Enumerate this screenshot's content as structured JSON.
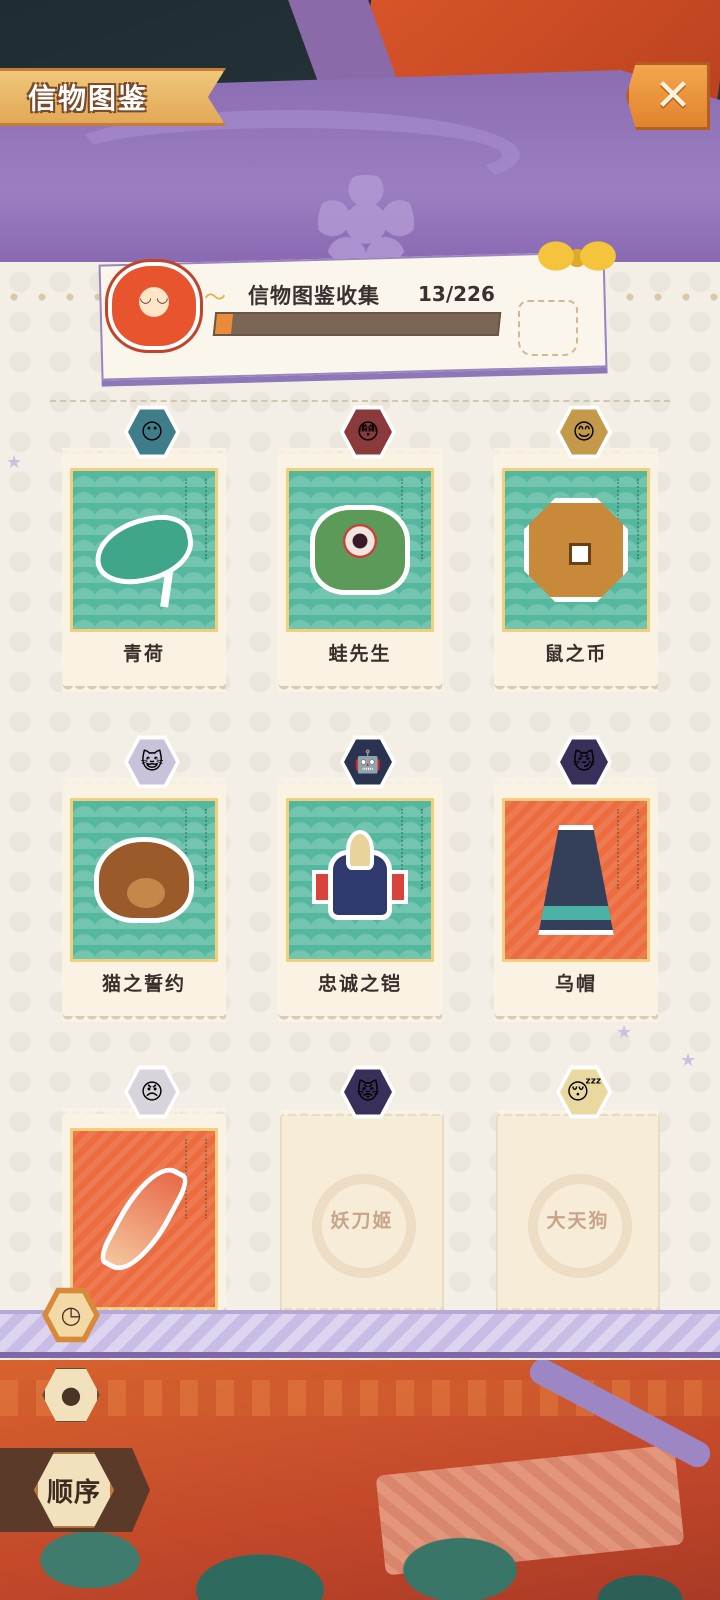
{
  "header": {
    "title": "信物图鉴",
    "close_icon": "close-x-icon"
  },
  "collection": {
    "label": "信物图鉴收集",
    "count_text": "13/226",
    "collected": 13,
    "total": 226
  },
  "cards": [
    {
      "name": "青荷",
      "locked": false,
      "bg": "green",
      "art": "leaf-icon",
      "avatar": "shikigami-avatar-1",
      "avatar_color": "#3f7d8a"
    },
    {
      "name": "蛙先生",
      "locked": false,
      "bg": "green",
      "art": "frog-icon",
      "avatar": "shikigami-avatar-2",
      "avatar_color": "#8a3a3a"
    },
    {
      "name": "鼠之币",
      "locked": false,
      "bg": "green",
      "art": "coin-icon",
      "avatar": "shikigami-avatar-3",
      "avatar_color": "#c49a4a"
    },
    {
      "name": "猫之誓约",
      "locked": false,
      "bg": "green",
      "art": "paw-icon",
      "avatar": "shikigami-avatar-4",
      "avatar_color": "#c9c2d8"
    },
    {
      "name": "忠诚之铠",
      "locked": false,
      "bg": "green",
      "art": "armor-icon",
      "avatar": "shikigami-avatar-5",
      "avatar_color": "#2a3350"
    },
    {
      "name": "乌帽",
      "locked": false,
      "bg": "red",
      "art": "hat-icon",
      "avatar": "shikigami-avatar-6",
      "avatar_color": "#3a2f5a"
    },
    {
      "name": "",
      "locked": false,
      "bg": "red",
      "art": "feather-icon",
      "avatar": "shikigami-avatar-7",
      "avatar_color": "#d9d4dc"
    },
    {
      "name": "妖刀姬",
      "locked": true,
      "bg": "cream",
      "art": "",
      "avatar": "shikigami-avatar-8",
      "avatar_color": "#3a2f5a"
    },
    {
      "name": "大天狗",
      "locked": true,
      "bg": "cream",
      "art": "",
      "avatar": "shikigami-avatar-9",
      "avatar_color": "#e9d9a0"
    }
  ],
  "side_buttons": {
    "history_icon": "clock-icon",
    "filter_icon": "shikigami-filter-icon",
    "sort_label": "顺序"
  },
  "colors": {
    "accent_orange": "#e98b3a",
    "header_purple": "#8b6db2",
    "card_green": "#55b89e",
    "card_red": "#ec6b3f"
  }
}
